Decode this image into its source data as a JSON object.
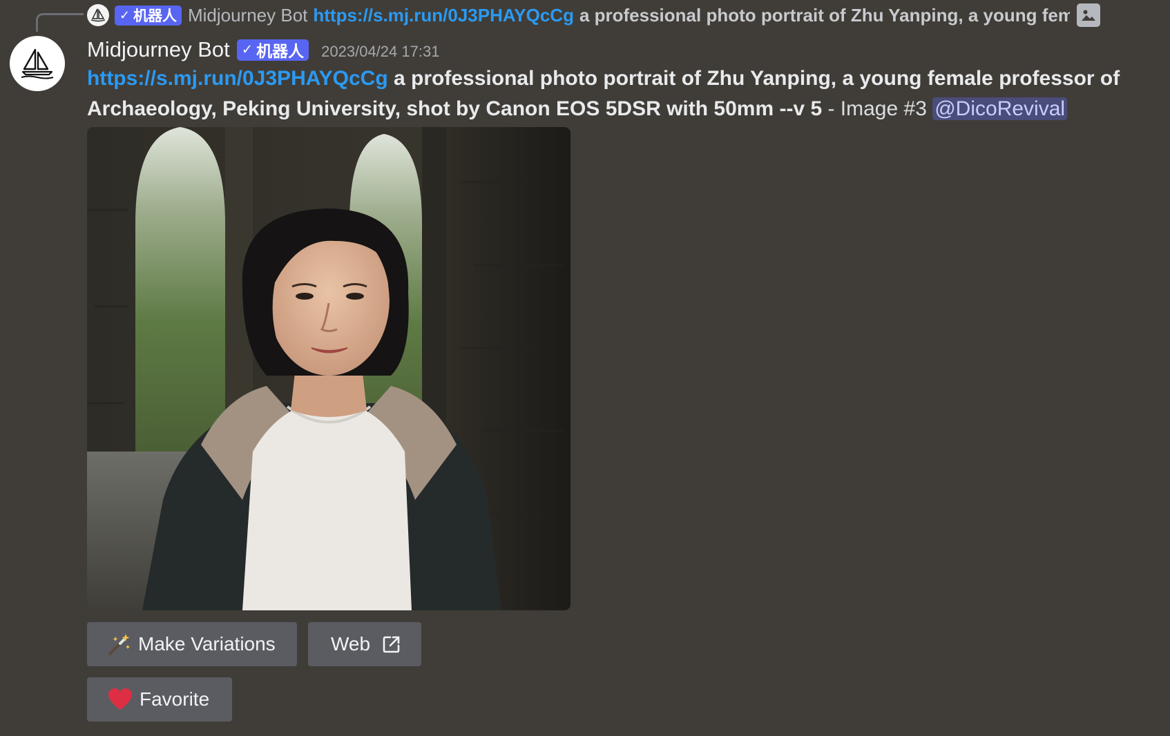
{
  "reply": {
    "bot_tag": "机器人",
    "author": "Midjourney Bot",
    "link": "https://s.mj.run/0J3PHAYQcCg",
    "text": "a professional photo portrait of Zhu Yanping, a young fem"
  },
  "message": {
    "author": "Midjourney Bot",
    "bot_tag": "机器人",
    "timestamp": "2023/04/24 17:31",
    "link": "https://s.mj.run/0J3PHAYQcCg",
    "prompt": "a professional photo portrait of Zhu Yanping, a young female professor of Archaeology, Peking University, shot by Canon EOS 5DSR with 50mm --v 5",
    "suffix": " - Image #3 ",
    "mention": "@DicoRevival"
  },
  "buttons": {
    "make_variations": "Make Variations",
    "web": "Web",
    "favorite": "Favorite"
  },
  "icons": {
    "avatar": "sailboat-icon",
    "reply_attachment": "image-icon",
    "make_variations": "magic-wand-icon",
    "web": "external-link-icon",
    "favorite": "heart-icon"
  },
  "colors": {
    "background": "#403d38",
    "link": "#2b9af3",
    "bot_tag": "#5865f2",
    "button": "#5b5c61",
    "mention_bg": "#4a4d7a",
    "heart": "#dd2e44"
  }
}
